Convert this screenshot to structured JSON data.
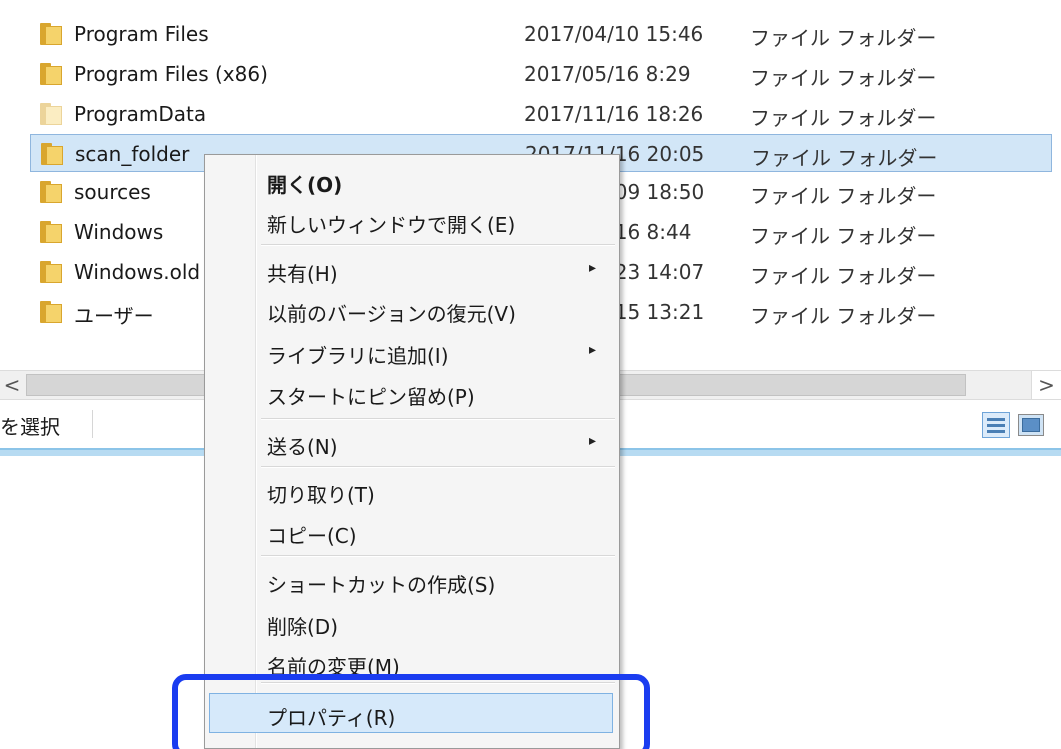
{
  "files": [
    {
      "name": "Program Files",
      "date": "2017/04/10 15:46",
      "type": "ファイル フォルダー",
      "icon": "folder-icon",
      "selected": false
    },
    {
      "name": "Program Files (x86)",
      "date": "2017/05/16 8:29",
      "type": "ファイル フォルダー",
      "icon": "folder-icon",
      "selected": false
    },
    {
      "name": "ProgramData",
      "date": "2017/11/16 18:26",
      "type": "ファイル フォルダー",
      "icon": "folder-icon",
      "selected": false
    },
    {
      "name": "scan_folder",
      "date": "2017/11/16 20:05",
      "type": "ファイル フォルダー",
      "icon": "folder-icon",
      "selected": true
    },
    {
      "name": "sources",
      "date": "/09 18:50",
      "type": "ファイル フォルダー",
      "icon": "folder-icon",
      "selected": false
    },
    {
      "name": "Windows",
      "date": "/16 8:44",
      "type": "ファイル フォルダー",
      "icon": "folder-icon",
      "selected": false
    },
    {
      "name": "Windows.old",
      "date": "/23 14:07",
      "type": "ファイル フォルダー",
      "icon": "folder-icon",
      "selected": false
    },
    {
      "name": "ユーザー",
      "date": "/15 13:21",
      "type": "ファイル フォルダー",
      "icon": "folder-icon",
      "selected": false
    }
  ],
  "scrollbar": {
    "left_arrow": "<",
    "right_arrow": ">"
  },
  "status": {
    "text": "を選択"
  },
  "context_menu": {
    "items": [
      {
        "label": "開く(O)",
        "bold": true
      },
      {
        "label": "新しいウィンドウで開く(E)"
      },
      {
        "separator": true
      },
      {
        "label": "共有(H)",
        "submenu": true
      },
      {
        "label": "以前のバージョンの復元(V)"
      },
      {
        "label": "ライブラリに追加(I)",
        "submenu": true
      },
      {
        "label": "スタートにピン留め(P)"
      },
      {
        "separator": true
      },
      {
        "label": "送る(N)",
        "submenu": true
      },
      {
        "separator": true
      },
      {
        "label": "切り取り(T)"
      },
      {
        "label": "コピー(C)"
      },
      {
        "separator": true
      },
      {
        "label": "ショートカットの作成(S)"
      },
      {
        "label": "削除(D)"
      },
      {
        "label": "名前の変更(M)"
      },
      {
        "separator": true
      },
      {
        "label": "プロパティ(R)",
        "highlighted": true
      }
    ],
    "submenu_arrow": "▸"
  },
  "colors": {
    "selection": "#d2e6f7",
    "menu_highlight": "#d6e9fa",
    "callout_outline": "#1a3cf0"
  }
}
